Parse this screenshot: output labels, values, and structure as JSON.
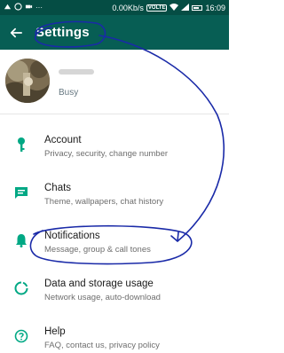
{
  "status_bar": {
    "speed": "0.00Kb/s",
    "network_badge": "VOLTE",
    "time": "16:09",
    "icons": [
      "notification-icon",
      "whatsapp-icon",
      "video-icon",
      "more-icon",
      "wifi-icon",
      "signal-icon",
      "battery-icon"
    ]
  },
  "header": {
    "title": "Settings",
    "back_icon": "arrow-left-icon",
    "background": "#075e54"
  },
  "profile": {
    "about": "Busy"
  },
  "settings": [
    {
      "label": "Account",
      "sub": "Privacy, security, change number",
      "icon": "key-icon"
    },
    {
      "label": "Chats",
      "sub": "Theme, wallpapers, chat history",
      "icon": "chat-icon"
    },
    {
      "label": "Notifications",
      "sub": "Message, group & call tones",
      "icon": "bell-icon"
    },
    {
      "label": "Data and storage usage",
      "sub": "Network usage, auto-download",
      "icon": "data-usage-icon"
    },
    {
      "label": "Help",
      "sub": "FAQ, contact us, privacy policy",
      "icon": "help-icon"
    }
  ],
  "colors": {
    "status_bar": "#054d44",
    "icon_teal": "#00a884",
    "annotation_pen": "#1a2aa8"
  }
}
